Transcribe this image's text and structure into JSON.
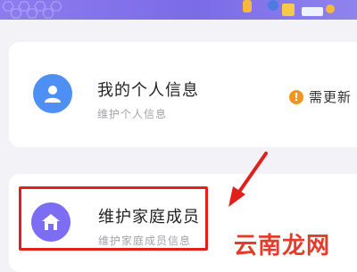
{
  "personal_info": {
    "title": "我的个人信息",
    "subtitle": "维护个人信息",
    "status_icon": "!",
    "status_text": "需更新"
  },
  "family": {
    "title": "维护家庭成员",
    "subtitle": "维护家庭成员信息"
  },
  "watermark": "云南龙网",
  "colors": {
    "banner": "#7b6be6",
    "avatar_blue": "#4e8ff3",
    "avatar_purple": "#7c6df2",
    "warning": "#f39322",
    "highlight": "#e0211b"
  },
  "icons": {
    "personal": "person-icon",
    "family": "house-icon",
    "status": "exclamation-icon"
  }
}
